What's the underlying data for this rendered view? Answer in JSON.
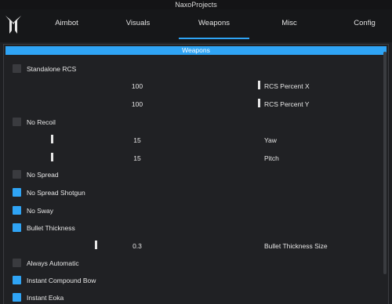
{
  "window": {
    "title": "NaxoProjects"
  },
  "header": {
    "tabs": [
      {
        "label": "Aimbot",
        "active": false
      },
      {
        "label": "Visuals",
        "active": false
      },
      {
        "label": "Weapons",
        "active": true
      },
      {
        "label": "Misc",
        "active": false
      },
      {
        "label": "Config",
        "active": false
      }
    ]
  },
  "section": {
    "title": "Weapons"
  },
  "options": {
    "standalone_rcs": {
      "label": "Standalone RCS",
      "checked": false
    },
    "rcs_percent_x": {
      "label": "RCS Percent X",
      "value": "100"
    },
    "rcs_percent_y": {
      "label": "RCS Percent Y",
      "value": "100"
    },
    "no_recoil": {
      "label": "No Recoil",
      "checked": false
    },
    "yaw": {
      "label": "Yaw",
      "value": "15"
    },
    "pitch": {
      "label": "Pitch",
      "value": "15"
    },
    "no_spread": {
      "label": "No Spread",
      "checked": false
    },
    "no_spread_shotgun": {
      "label": "No Spread Shotgun",
      "checked": true
    },
    "no_sway": {
      "label": "No Sway",
      "checked": true
    },
    "bullet_thickness": {
      "label": "Bullet Thickness",
      "checked": true
    },
    "bullet_thickness_size": {
      "label": "Bullet Thickness Size",
      "value": "0.3"
    },
    "always_automatic": {
      "label": "Always Automatic",
      "checked": false
    },
    "instant_compound_bow": {
      "label": "Instant Compound Bow",
      "checked": true
    },
    "instant_eoka": {
      "label": "Instant Eoka",
      "checked": true
    }
  },
  "colors": {
    "accent": "#2fa4f5",
    "background": "#202124",
    "header": "#161719",
    "checkbox_off": "#3a3b3f"
  }
}
